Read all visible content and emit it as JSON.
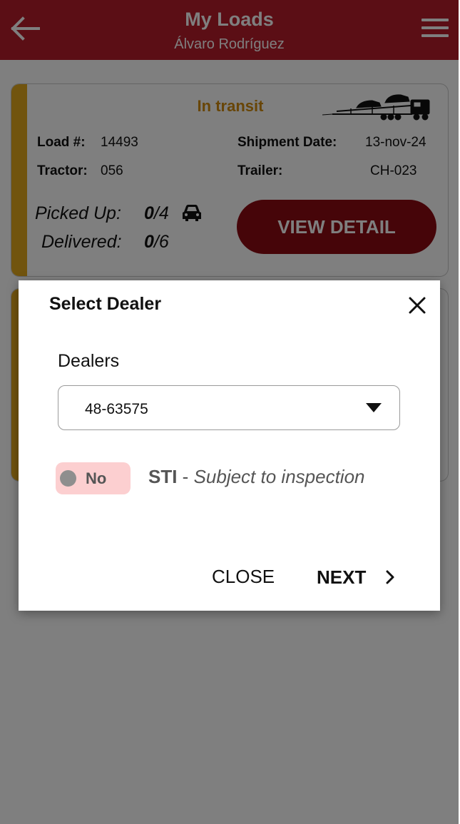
{
  "header": {
    "title": "My Loads",
    "subtitle": "Álvaro Rodríguez"
  },
  "load_card": {
    "status": "In transit",
    "load_label": "Load #:",
    "load_value": "14493",
    "shipment_date_label": "Shipment Date:",
    "shipment_date_value": "13-nov-24",
    "tractor_label": "Tractor:",
    "tractor_value": "056",
    "trailer_label": "Trailer:",
    "trailer_value": "CH-023",
    "picked_up_label": "Picked Up:",
    "picked_up_done": "0",
    "picked_up_total": "/4",
    "delivered_label": "Delivered:",
    "delivered_done": "0",
    "delivered_total": "/6",
    "view_detail_label": "VIEW DETAIL",
    "status_color": "#d08a0d",
    "stripe_color": "#e3a81c"
  },
  "modal": {
    "title": "Select Dealer",
    "dealers_label": "Dealers",
    "selected_dealer": "48-63575",
    "sti_toggle_label": "No",
    "sti_code": "STI",
    "sti_separator": " - ",
    "sti_description": "Subject to inspection",
    "close_label": "CLOSE",
    "next_label": "NEXT"
  },
  "colors": {
    "header_red": "#b71c2a",
    "button_dark_red": "#8c0b13",
    "toggle_pink": "#fccfd0"
  },
  "icons": {
    "back": "arrow-left-icon",
    "menu": "hamburger-menu-icon",
    "truck": "car-carrier-truck-icon",
    "car": "car-icon",
    "close": "close-icon",
    "dropdown": "caret-down-icon",
    "next": "chevron-right-icon"
  }
}
